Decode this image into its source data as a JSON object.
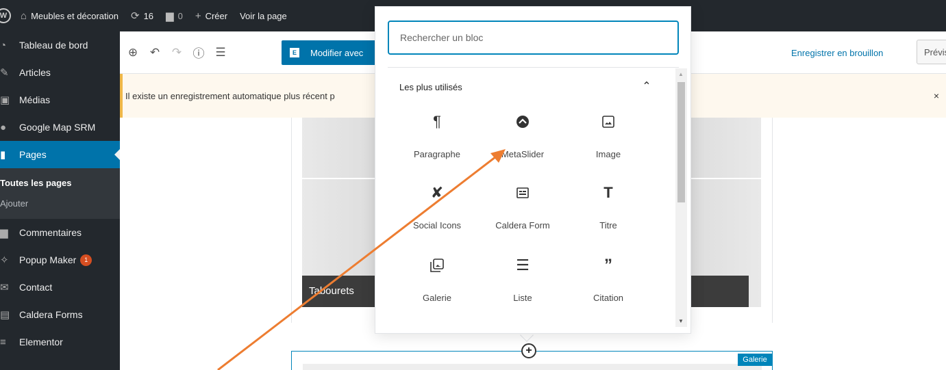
{
  "adminbar": {
    "site_name": "Meubles et décoration",
    "updates_count": "16",
    "comments_count": "0",
    "create_label": "Créer",
    "view_page_label": "Voir la page"
  },
  "sidebar": {
    "items": [
      {
        "label": "Tableau de bord"
      },
      {
        "label": "Articles"
      },
      {
        "label": "Médias"
      },
      {
        "label": "Google Map SRM"
      },
      {
        "label": "Pages"
      },
      {
        "label": "Commentaires"
      },
      {
        "label": "Popup Maker",
        "badge": "1"
      },
      {
        "label": "Contact"
      },
      {
        "label": "Caldera Forms"
      },
      {
        "label": "Elementor"
      }
    ],
    "submenu": {
      "all_pages": "Toutes les pages",
      "add": "Ajouter"
    }
  },
  "editor": {
    "elementor_button": "Modifier avec",
    "save_draft": "Enregistrer en brouillon",
    "preview": "Prévisualiser"
  },
  "notice": {
    "text": "Il existe un enregistrement automatique plus récent p",
    "close": "×"
  },
  "gallery": {
    "caption": "Tabourets",
    "block_tag": "Galerie"
  },
  "inserter": {
    "search_placeholder": "Rechercher un bloc",
    "panel_title": "Les plus utilisés",
    "blocks": [
      {
        "label": "Paragraphe",
        "icon": "paragraph-icon"
      },
      {
        "label": "MetaSlider",
        "icon": "metaslider-icon"
      },
      {
        "label": "Image",
        "icon": "image-icon"
      },
      {
        "label": "Social Icons",
        "icon": "social-icons-icon"
      },
      {
        "label": "Caldera Form",
        "icon": "caldera-form-icon"
      },
      {
        "label": "Titre",
        "icon": "heading-icon"
      },
      {
        "label": "Galerie",
        "icon": "gallery-icon"
      },
      {
        "label": "Liste",
        "icon": "list-icon"
      },
      {
        "label": "Citation",
        "icon": "quote-icon"
      }
    ]
  },
  "colors": {
    "admin_dark": "#23282d",
    "wp_blue": "#0073aa",
    "annotation_orange": "#ed7d31"
  }
}
